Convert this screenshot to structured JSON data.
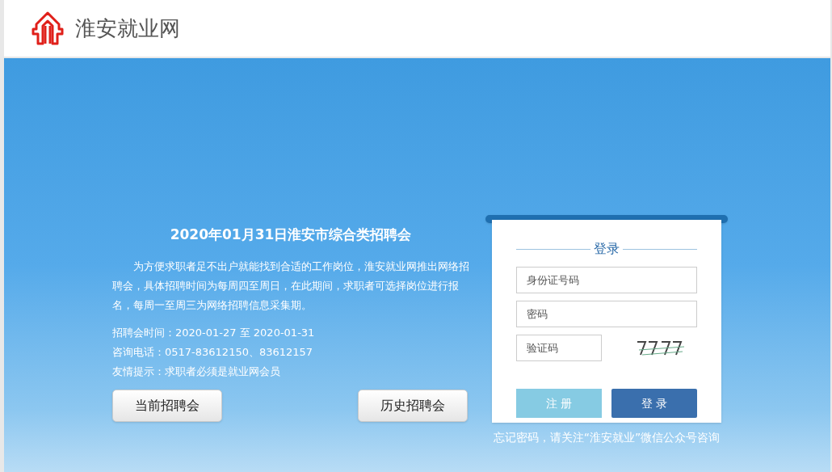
{
  "header": {
    "site_name": "淮安就业网"
  },
  "fair": {
    "title": "2020年01月31日淮安市综合类招聘会",
    "intro": "为方便求职者足不出户就能找到合适的工作岗位，淮安就业网推出网络招聘会，具体招聘时间为每周四至周日，在此期间，求职者可选择岗位进行报名，每周一至周三为网络招聘信息采集期。",
    "details": [
      "招聘会时间：2020-01-27 至 2020-01-31",
      "咨询电话：0517-83612150、83612157",
      "友情提示：求职者必须是就业网会员"
    ],
    "buttons": [
      "当前招聘会",
      "历史招聘会"
    ]
  },
  "login": {
    "title": "登录",
    "fields": [
      {
        "kind": "full",
        "placeholder": "身份证号码"
      },
      {
        "kind": "full",
        "placeholder": "密码"
      },
      {
        "kind": "captcha",
        "placeholder": "验证码"
      }
    ],
    "register_button": "注 册",
    "login_button": "登 录"
  },
  "footer_note": "忘记密码，请关注“淮安就业”微信公众号咨询"
}
